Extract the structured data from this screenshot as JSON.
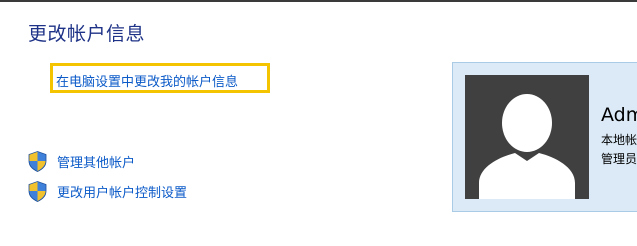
{
  "page": {
    "title": "更改帐户信息"
  },
  "links": {
    "pc_settings": "在电脑设置中更改我的帐户信息",
    "manage_other": "管理其他帐户",
    "uac_settings": "更改用户帐户控制设置"
  },
  "account": {
    "name": "Adm",
    "type_line": "本地帐",
    "role_line": "管理员"
  },
  "icons": {
    "shield": "uac-shield-icon",
    "avatar": "default-user-avatar"
  },
  "colors": {
    "title": "#1e3287",
    "link": "#0b5ac8",
    "highlight": "#f5c400",
    "panel_bg": "#dbeaf6",
    "avatar_bg": "#404040"
  }
}
